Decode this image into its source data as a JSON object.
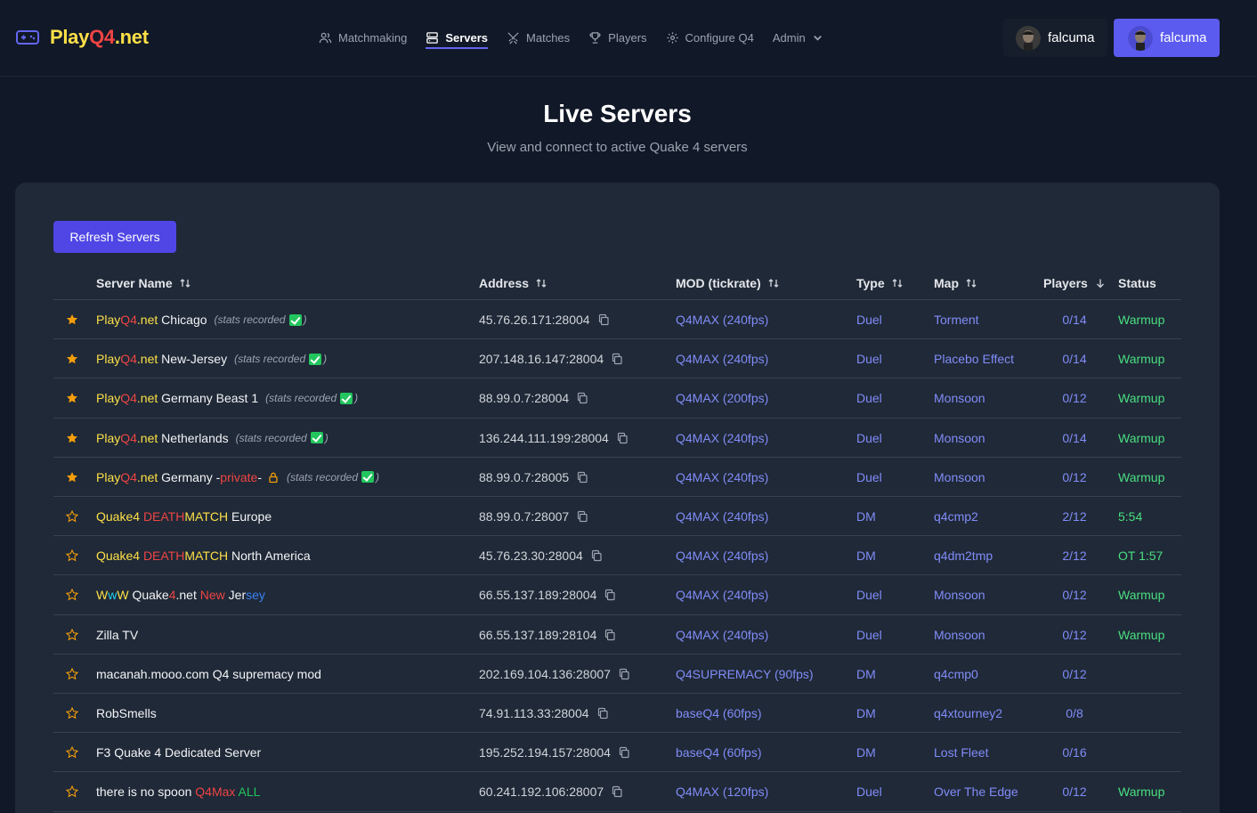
{
  "brand": {
    "parts": [
      {
        "text": "Play",
        "color": "yellow"
      },
      {
        "text": "Q4",
        "color": "red"
      },
      {
        "text": ".net",
        "color": "yellow"
      }
    ],
    "icon": "gamepad-icon"
  },
  "nav": {
    "matchmaking": "Matchmaking",
    "servers": "Servers",
    "matches": "Matches",
    "players": "Players",
    "configure": "Configure Q4",
    "admin": "Admin"
  },
  "user": {
    "name": "falcuma",
    "name_button": "falcuma"
  },
  "page": {
    "title": "Live Servers",
    "subtitle": "View and connect to active Quake 4 servers"
  },
  "toolbar": {
    "refresh_label": "Refresh Servers"
  },
  "columns": {
    "server_name": "Server Name",
    "address": "Address",
    "mod": "MOD (tickrate)",
    "type": "Type",
    "map": "Map",
    "players": "Players",
    "status": "Status"
  },
  "stats_label": {
    "open": "(stats recorded",
    "close": ")"
  },
  "servers": [
    {
      "favorite": true,
      "name_parts": [
        {
          "text": "Play",
          "color": "yellow"
        },
        {
          "text": "Q4",
          "color": "red"
        },
        {
          "text": ".net",
          "color": "yellow"
        },
        {
          "text": " Chicago",
          "color": "white"
        }
      ],
      "stats": true,
      "locked": false,
      "address": "45.76.26.171:28004",
      "mod": "Q4MAX (240fps)",
      "type": "Duel",
      "map": "Torment",
      "players": "0/14",
      "status": "Warmup"
    },
    {
      "favorite": true,
      "name_parts": [
        {
          "text": "Play",
          "color": "yellow"
        },
        {
          "text": "Q4",
          "color": "red"
        },
        {
          "text": ".net",
          "color": "yellow"
        },
        {
          "text": " New-Jersey",
          "color": "white"
        }
      ],
      "stats": true,
      "locked": false,
      "address": "207.148.16.147:28004",
      "mod": "Q4MAX (240fps)",
      "type": "Duel",
      "map": "Placebo Effect",
      "players": "0/14",
      "status": "Warmup"
    },
    {
      "favorite": true,
      "name_parts": [
        {
          "text": "Play",
          "color": "yellow"
        },
        {
          "text": "Q4",
          "color": "red"
        },
        {
          "text": ".net",
          "color": "yellow"
        },
        {
          "text": " Germany Beast 1",
          "color": "white"
        }
      ],
      "stats": true,
      "locked": false,
      "address": "88.99.0.7:28004",
      "mod": "Q4MAX (200fps)",
      "type": "Duel",
      "map": "Monsoon",
      "players": "0/12",
      "status": "Warmup"
    },
    {
      "favorite": true,
      "name_parts": [
        {
          "text": "Play",
          "color": "yellow"
        },
        {
          "text": "Q4",
          "color": "red"
        },
        {
          "text": ".net",
          "color": "yellow"
        },
        {
          "text": " Netherlands",
          "color": "white"
        }
      ],
      "stats": true,
      "locked": false,
      "address": "136.244.111.199:28004",
      "mod": "Q4MAX (240fps)",
      "type": "Duel",
      "map": "Monsoon",
      "players": "0/14",
      "status": "Warmup"
    },
    {
      "favorite": true,
      "name_parts": [
        {
          "text": "Play",
          "color": "yellow"
        },
        {
          "text": "Q4",
          "color": "red"
        },
        {
          "text": ".net",
          "color": "yellow"
        },
        {
          "text": " Germany -",
          "color": "white"
        },
        {
          "text": "private",
          "color": "red"
        },
        {
          "text": "-",
          "color": "white"
        }
      ],
      "stats": true,
      "locked": true,
      "address": "88.99.0.7:28005",
      "mod": "Q4MAX (240fps)",
      "type": "Duel",
      "map": "Monsoon",
      "players": "0/12",
      "status": "Warmup"
    },
    {
      "favorite": false,
      "name_parts": [
        {
          "text": "Quake4 ",
          "color": "yellow"
        },
        {
          "text": "DEATH",
          "color": "red"
        },
        {
          "text": "MATCH",
          "color": "yellow"
        },
        {
          "text": " Europe",
          "color": "white"
        }
      ],
      "stats": false,
      "locked": false,
      "address": "88.99.0.7:28007",
      "mod": "Q4MAX (240fps)",
      "type": "DM",
      "map": "q4cmp2",
      "players": "2/12",
      "status": "5:54"
    },
    {
      "favorite": false,
      "name_parts": [
        {
          "text": "Quake4 ",
          "color": "yellow"
        },
        {
          "text": "DEATH",
          "color": "red"
        },
        {
          "text": "MATCH",
          "color": "yellow"
        },
        {
          "text": " North America",
          "color": "white"
        }
      ],
      "stats": false,
      "locked": false,
      "address": "45.76.23.30:28004",
      "mod": "Q4MAX (240fps)",
      "type": "DM",
      "map": "q4dm2tmp",
      "players": "2/12",
      "status": "OT 1:57"
    },
    {
      "favorite": false,
      "name_parts": [
        {
          "text": "W",
          "color": "yellow"
        },
        {
          "text": "w",
          "color": "cyan"
        },
        {
          "text": "W",
          "color": "yellow"
        },
        {
          "text": " Quake",
          "color": "white"
        },
        {
          "text": "4",
          "color": "red"
        },
        {
          "text": ".net ",
          "color": "white"
        },
        {
          "text": "New",
          "color": "red"
        },
        {
          "text": " Jer",
          "color": "white"
        },
        {
          "text": "sey",
          "color": "blue"
        }
      ],
      "stats": false,
      "locked": false,
      "address": "66.55.137.189:28004",
      "mod": "Q4MAX (240fps)",
      "type": "Duel",
      "map": "Monsoon",
      "players": "0/12",
      "status": "Warmup"
    },
    {
      "favorite": false,
      "name_parts": [
        {
          "text": "Zilla TV",
          "color": "white"
        }
      ],
      "stats": false,
      "locked": false,
      "address": "66.55.137.189:28104",
      "mod": "Q4MAX (240fps)",
      "type": "Duel",
      "map": "Monsoon",
      "players": "0/12",
      "status": "Warmup"
    },
    {
      "favorite": false,
      "name_parts": [
        {
          "text": "macanah.mooo.com Q4 supremacy mod",
          "color": "white"
        }
      ],
      "stats": false,
      "locked": false,
      "address": "202.169.104.136:28007",
      "mod": "Q4SUPREMACY (90fps)",
      "type": "DM",
      "map": "q4cmp0",
      "players": "0/12",
      "status": ""
    },
    {
      "favorite": false,
      "name_parts": [
        {
          "text": "RobSmells",
          "color": "white"
        }
      ],
      "stats": false,
      "locked": false,
      "address": "74.91.113.33:28004",
      "mod": "baseQ4 (60fps)",
      "type": "DM",
      "map": "q4xtourney2",
      "players": "0/8",
      "status": ""
    },
    {
      "favorite": false,
      "name_parts": [
        {
          "text": "F3 Quake 4 Dedicated Server",
          "color": "white"
        }
      ],
      "stats": false,
      "locked": false,
      "address": "195.252.194.157:28004",
      "mod": "baseQ4 (60fps)",
      "type": "DM",
      "map": "Lost Fleet",
      "players": "0/16",
      "status": ""
    },
    {
      "favorite": false,
      "name_parts": [
        {
          "text": "there is no spoon ",
          "color": "white"
        },
        {
          "text": "Q4Max",
          "color": "red"
        },
        {
          "text": " ALL",
          "color": "green"
        }
      ],
      "stats": false,
      "locked": false,
      "address": "60.241.192.106:28007",
      "mod": "Q4MAX (120fps)",
      "type": "Duel",
      "map": "Over The Edge",
      "players": "0/12",
      "status": "Warmup"
    }
  ]
}
